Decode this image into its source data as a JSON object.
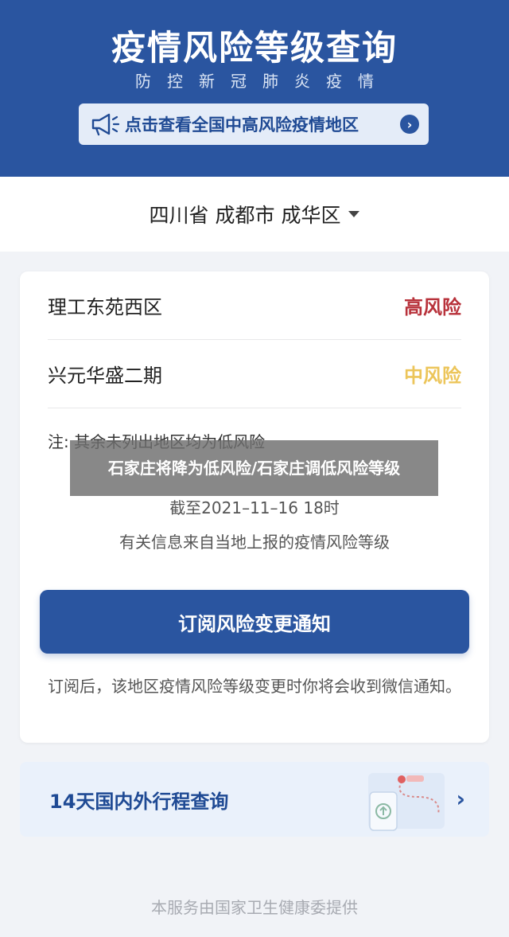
{
  "header": {
    "title": "疫情风险等级查询",
    "subtitle": "防控新冠肺炎疫情",
    "link_icon": "megaphone-icon",
    "link_text": "点击查看全国中高风险疫情地区",
    "link_arrow": "›"
  },
  "region": {
    "label": "四川省 成都市 成华区"
  },
  "risk_list": [
    {
      "name": "理工东苑西区",
      "level": "高风险",
      "color": "#b8323b"
    },
    {
      "name": "兴元华盛二期",
      "level": "中风险",
      "color": "#ecc55a"
    }
  ],
  "note": "注: 其余未列出地区均为低风险",
  "cutoff_time": "截至2021–11–16 18时",
  "source_text": "有关信息来自当地上报的疫情风险等级",
  "subscribe_button": "订阅风险变更通知",
  "subscribe_note": "订阅后，该地区疫情风险等级变更时你将会收到微信通知。",
  "trip_query": {
    "label": "14天国内外行程查询",
    "chevron": "›"
  },
  "footer": "本服务由国家卫生健康委提供",
  "overlay_caption": "石家庄将降为低风险/石家庄调低风险等级",
  "colors": {
    "primary": "#2a55a0",
    "high_risk": "#b8323b",
    "medium_risk": "#ecc55a"
  }
}
